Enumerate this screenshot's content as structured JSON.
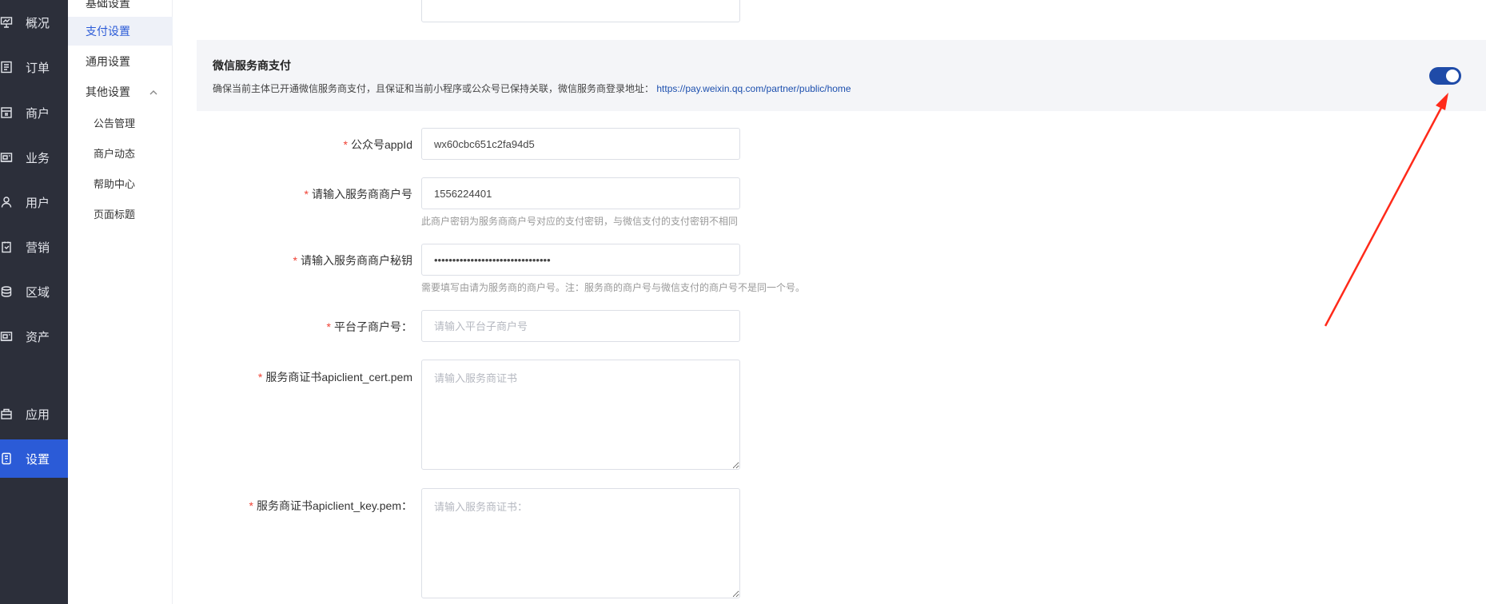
{
  "sidebar": {
    "items": [
      {
        "label": "概况",
        "icon": "chart-board-icon"
      },
      {
        "label": "订单",
        "icon": "order-list-icon"
      },
      {
        "label": "商户",
        "icon": "shop-icon"
      },
      {
        "label": "业务",
        "icon": "briefcase-icon"
      },
      {
        "label": "用户",
        "icon": "user-icon"
      },
      {
        "label": "营销",
        "icon": "marketing-icon"
      },
      {
        "label": "区域",
        "icon": "database-icon"
      },
      {
        "label": "资产",
        "icon": "wallet-icon"
      },
      {
        "label": "应用",
        "icon": "app-bag-icon"
      },
      {
        "label": "设置",
        "icon": "settings-icon"
      }
    ],
    "active": "设置"
  },
  "subnav": {
    "items": [
      {
        "label": "基础设置"
      },
      {
        "label": "支付设置"
      },
      {
        "label": "通用设置"
      },
      {
        "label": "其他设置"
      },
      {
        "label": "公告管理"
      },
      {
        "label": "商户动态"
      },
      {
        "label": "帮助中心"
      },
      {
        "label": "页面标题"
      }
    ],
    "active": "支付设置"
  },
  "banner": {
    "title": "微信服务商支付",
    "desc": "确保当前主体已开通微信服务商支付，且保证和当前小程序或公众号已保持关联，微信服务商登录地址：",
    "link": "https://pay.weixin.qq.com/partner/public/home",
    "enabled": true
  },
  "form": {
    "appid": {
      "label": "公众号appId",
      "value": "wx60cbc651c2fa94d5"
    },
    "mch_id": {
      "label": "请输入服务商商户号",
      "value": "1556224401",
      "hint": "此商户密钥为服务商商户号对应的支付密钥，与微信支付的支付密钥不相同"
    },
    "mch_key": {
      "label": "请输入服务商商户秘钥",
      "value": "••••••••••••••••••••••••••••••••",
      "hint": "需要填写由请为服务商的商户号。注：服务商的商户号与微信支付的商户号不是同一个号。"
    },
    "sub_mch": {
      "label": "平台子商户号：",
      "placeholder": "请输入平台子商户号"
    },
    "cert": {
      "label": "服务商证书apiclient_cert.pem",
      "placeholder": "请输入服务商证书"
    },
    "key": {
      "label": "服务商证书apiclient_key.pem：",
      "placeholder": "请输入服务商证书："
    }
  },
  "colors": {
    "sidebar_bg": "#2c2f3a",
    "accent": "#2b5bd7",
    "toggle_on": "#1f4ba8",
    "required": "#f04134",
    "annotation_arrow": "#ff2a1a"
  }
}
